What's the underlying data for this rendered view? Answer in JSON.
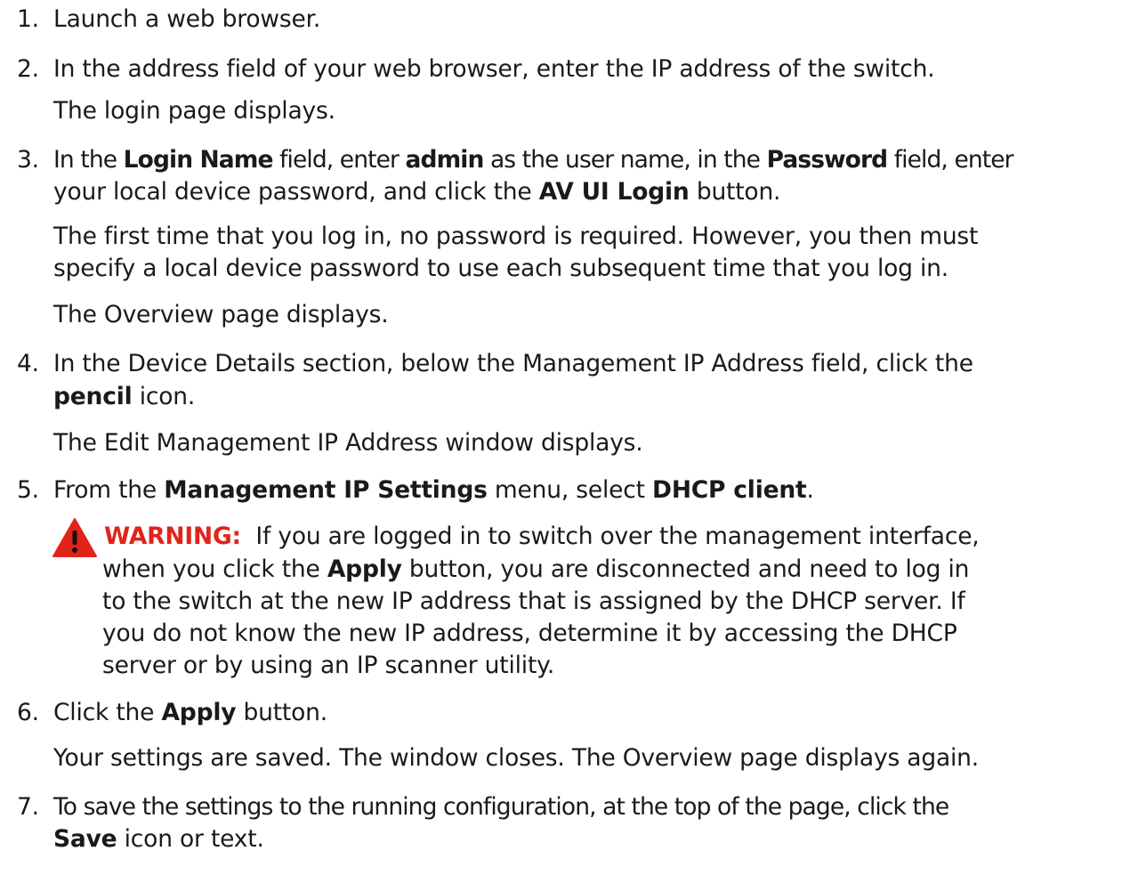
{
  "steps": {
    "s1": {
      "num": "1.",
      "line1": "Launch a web browser."
    },
    "s2": {
      "num": "2.",
      "line1": "In the address field of your web browser, enter the IP address of the switch.",
      "result": "The login page displays."
    },
    "s3": {
      "num": "3.",
      "line1_a": "In the ",
      "line1_b": "Login Name",
      "line1_c": " field, enter ",
      "line1_d": "admin",
      "line1_e": " as the user name, in the ",
      "line1_f": "Password",
      "line1_g": " field, enter",
      "line2_a": "your local device password, and click the ",
      "line2_b": "AV UI Login",
      "line2_c": " button.",
      "note1": "The first time that you log in, no password is required. However, you then must",
      "note2": "specify a local device password to use each subsequent time that you log in.",
      "result": "The Overview page displays."
    },
    "s4": {
      "num": "4.",
      "line1": "In the Device Details section, below the Management IP Address field, click the",
      "line2_a": "pencil",
      "line2_b": " icon.",
      "result": "The Edit Management IP Address window displays."
    },
    "s5": {
      "num": "5.",
      "line1_a": "From the ",
      "line1_b": "Management IP Settings",
      "line1_c": " menu, select ",
      "line1_d": "DHCP client",
      "line1_e": "."
    },
    "warning": {
      "icon": "warning-triangle-icon",
      "label": "WARNING:",
      "line1": "If you are logged in to switch over the management interface,",
      "line2_a": "when you click the ",
      "line2_b": "Apply",
      "line2_c": " button, you are disconnected and need to log in",
      "line3": "to the switch at the new IP address that is assigned by the DHCP server. If",
      "line4": "you do not know the new IP address, determine it by accessing the DHCP",
      "line5": "server or by using an IP scanner utility.",
      "colors": {
        "label": "#e2231a",
        "icon_fill": "#e2231a"
      }
    },
    "s6": {
      "num": "6.",
      "line1_a": "Click the ",
      "line1_b": "Apply",
      "line1_c": " button.",
      "result": "Your settings are saved. The window closes. The Overview page displays again."
    },
    "s7": {
      "num": "7.",
      "line1": "To save the settings to the running configuration, at the top of the page, click the",
      "line2_a": "Save",
      "line2_b": " icon or text."
    }
  }
}
